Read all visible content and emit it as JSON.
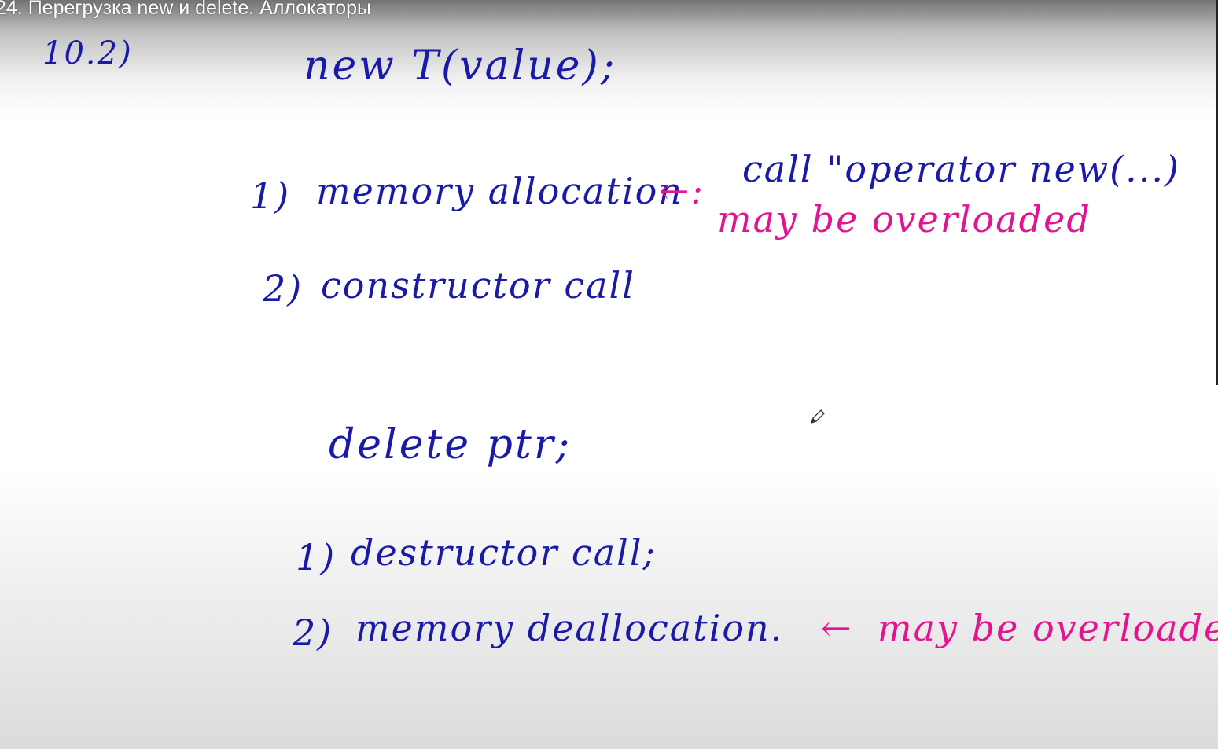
{
  "video": {
    "title": "24. Перегрузка new и delete. Аллокаторы"
  },
  "board": {
    "section_number": "10.2)",
    "new_expr": "new T(value);",
    "new_steps": [
      {
        "num": "1)",
        "text": "memory allocation"
      },
      {
        "num": "2)",
        "text": "constructor call"
      }
    ],
    "new_arrow": "←:",
    "new_call": "call \"operator new(...)",
    "new_note": "may be overloaded",
    "delete_expr": "delete ptr;",
    "delete_steps": [
      {
        "num": "1)",
        "text": "destructor call;"
      },
      {
        "num": "2)",
        "text": "memory deallocation."
      }
    ],
    "delete_arrow": "←",
    "delete_note": "may be overloaded"
  },
  "colors": {
    "ink_blue": "#1a1aa8",
    "ink_pink": "#e0158f",
    "board_bg": "#ffffff"
  },
  "icons": {
    "cursor": "pen-cursor-icon"
  }
}
